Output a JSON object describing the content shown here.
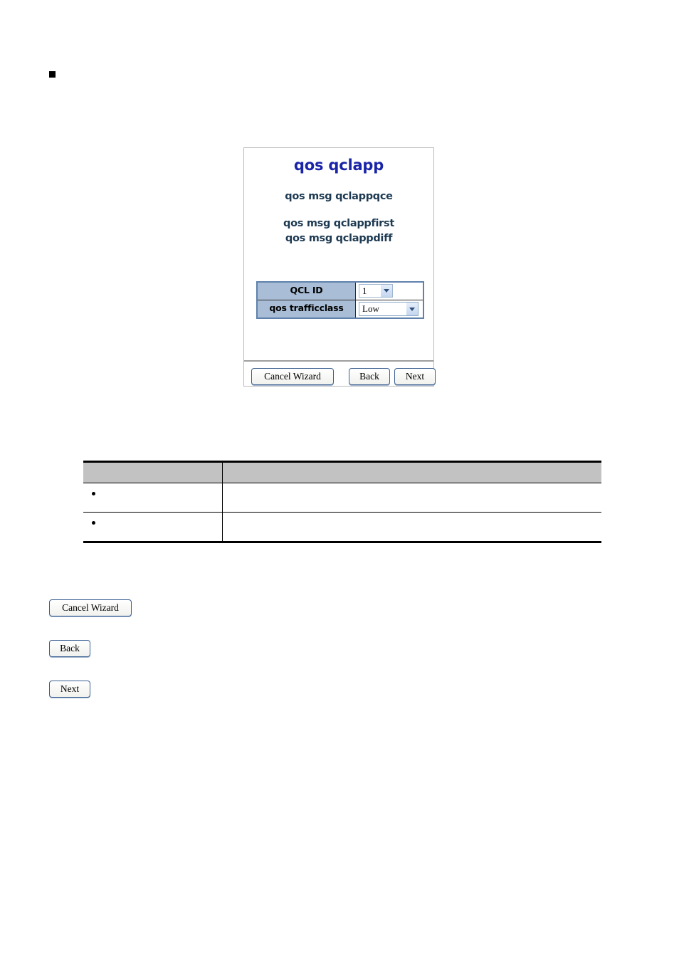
{
  "page": {
    "top_bullet": "■"
  },
  "wizard": {
    "title": "qos qclapp",
    "subtitle_1": "qos msg qclappqce",
    "subtitle_2": "qos msg qclappfirst",
    "subtitle_3": "qos msg qclappdiff",
    "form": {
      "rows": [
        {
          "label": "QCL ID",
          "value": "1"
        },
        {
          "label": "qos trafficclass",
          "value": "Low"
        }
      ]
    },
    "buttons": {
      "cancel": "Cancel Wizard",
      "back": "Back",
      "next": "Next"
    },
    "colors": {
      "title": "#1a24a8",
      "subtitle": "#1d3a52",
      "label_cell": "#a9bed6",
      "form_border": "#5f81ad",
      "button_border": "#3a5f91"
    }
  },
  "description_table": {
    "headers": [
      "",
      ""
    ],
    "rows": [
      {
        "object": "",
        "description": ""
      },
      {
        "object": "",
        "description": ""
      }
    ],
    "bullet": "•",
    "header_bg": "#c2c2c2"
  },
  "standalone_buttons": {
    "cancel": "Cancel Wizard",
    "back": "Back",
    "next": "Next"
  }
}
